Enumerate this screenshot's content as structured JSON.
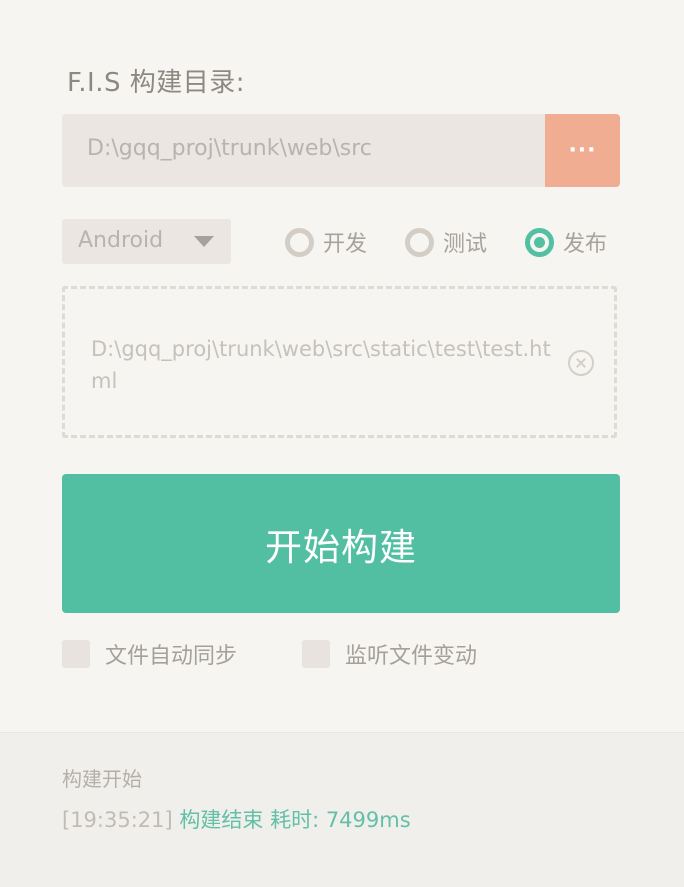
{
  "header": {
    "title": "F.I.S 构建目录:"
  },
  "directory": {
    "path": "D:\\gqq_proj\\trunk\\web\\src",
    "browse_label": "···"
  },
  "platform": {
    "selected": "Android"
  },
  "modes": [
    {
      "label": "开发",
      "checked": false
    },
    {
      "label": "测试",
      "checked": false
    },
    {
      "label": "发布",
      "checked": true
    }
  ],
  "file_drop": {
    "file_path": "D:\\gqq_proj\\trunk\\web\\src\\static\\test\\test.html"
  },
  "build_button": {
    "label": "开始构建"
  },
  "options": [
    {
      "label": "文件自动同步",
      "checked": false
    },
    {
      "label": "监听文件变动",
      "checked": false
    }
  ],
  "log": {
    "line1": "构建开始",
    "line2_time": "[19:35:21]",
    "line2_message": "构建结束 耗时: 7499ms"
  },
  "colors": {
    "accent_green": "#52bfa3",
    "accent_orange": "#f0ad91",
    "background": "#f6f5f2"
  }
}
